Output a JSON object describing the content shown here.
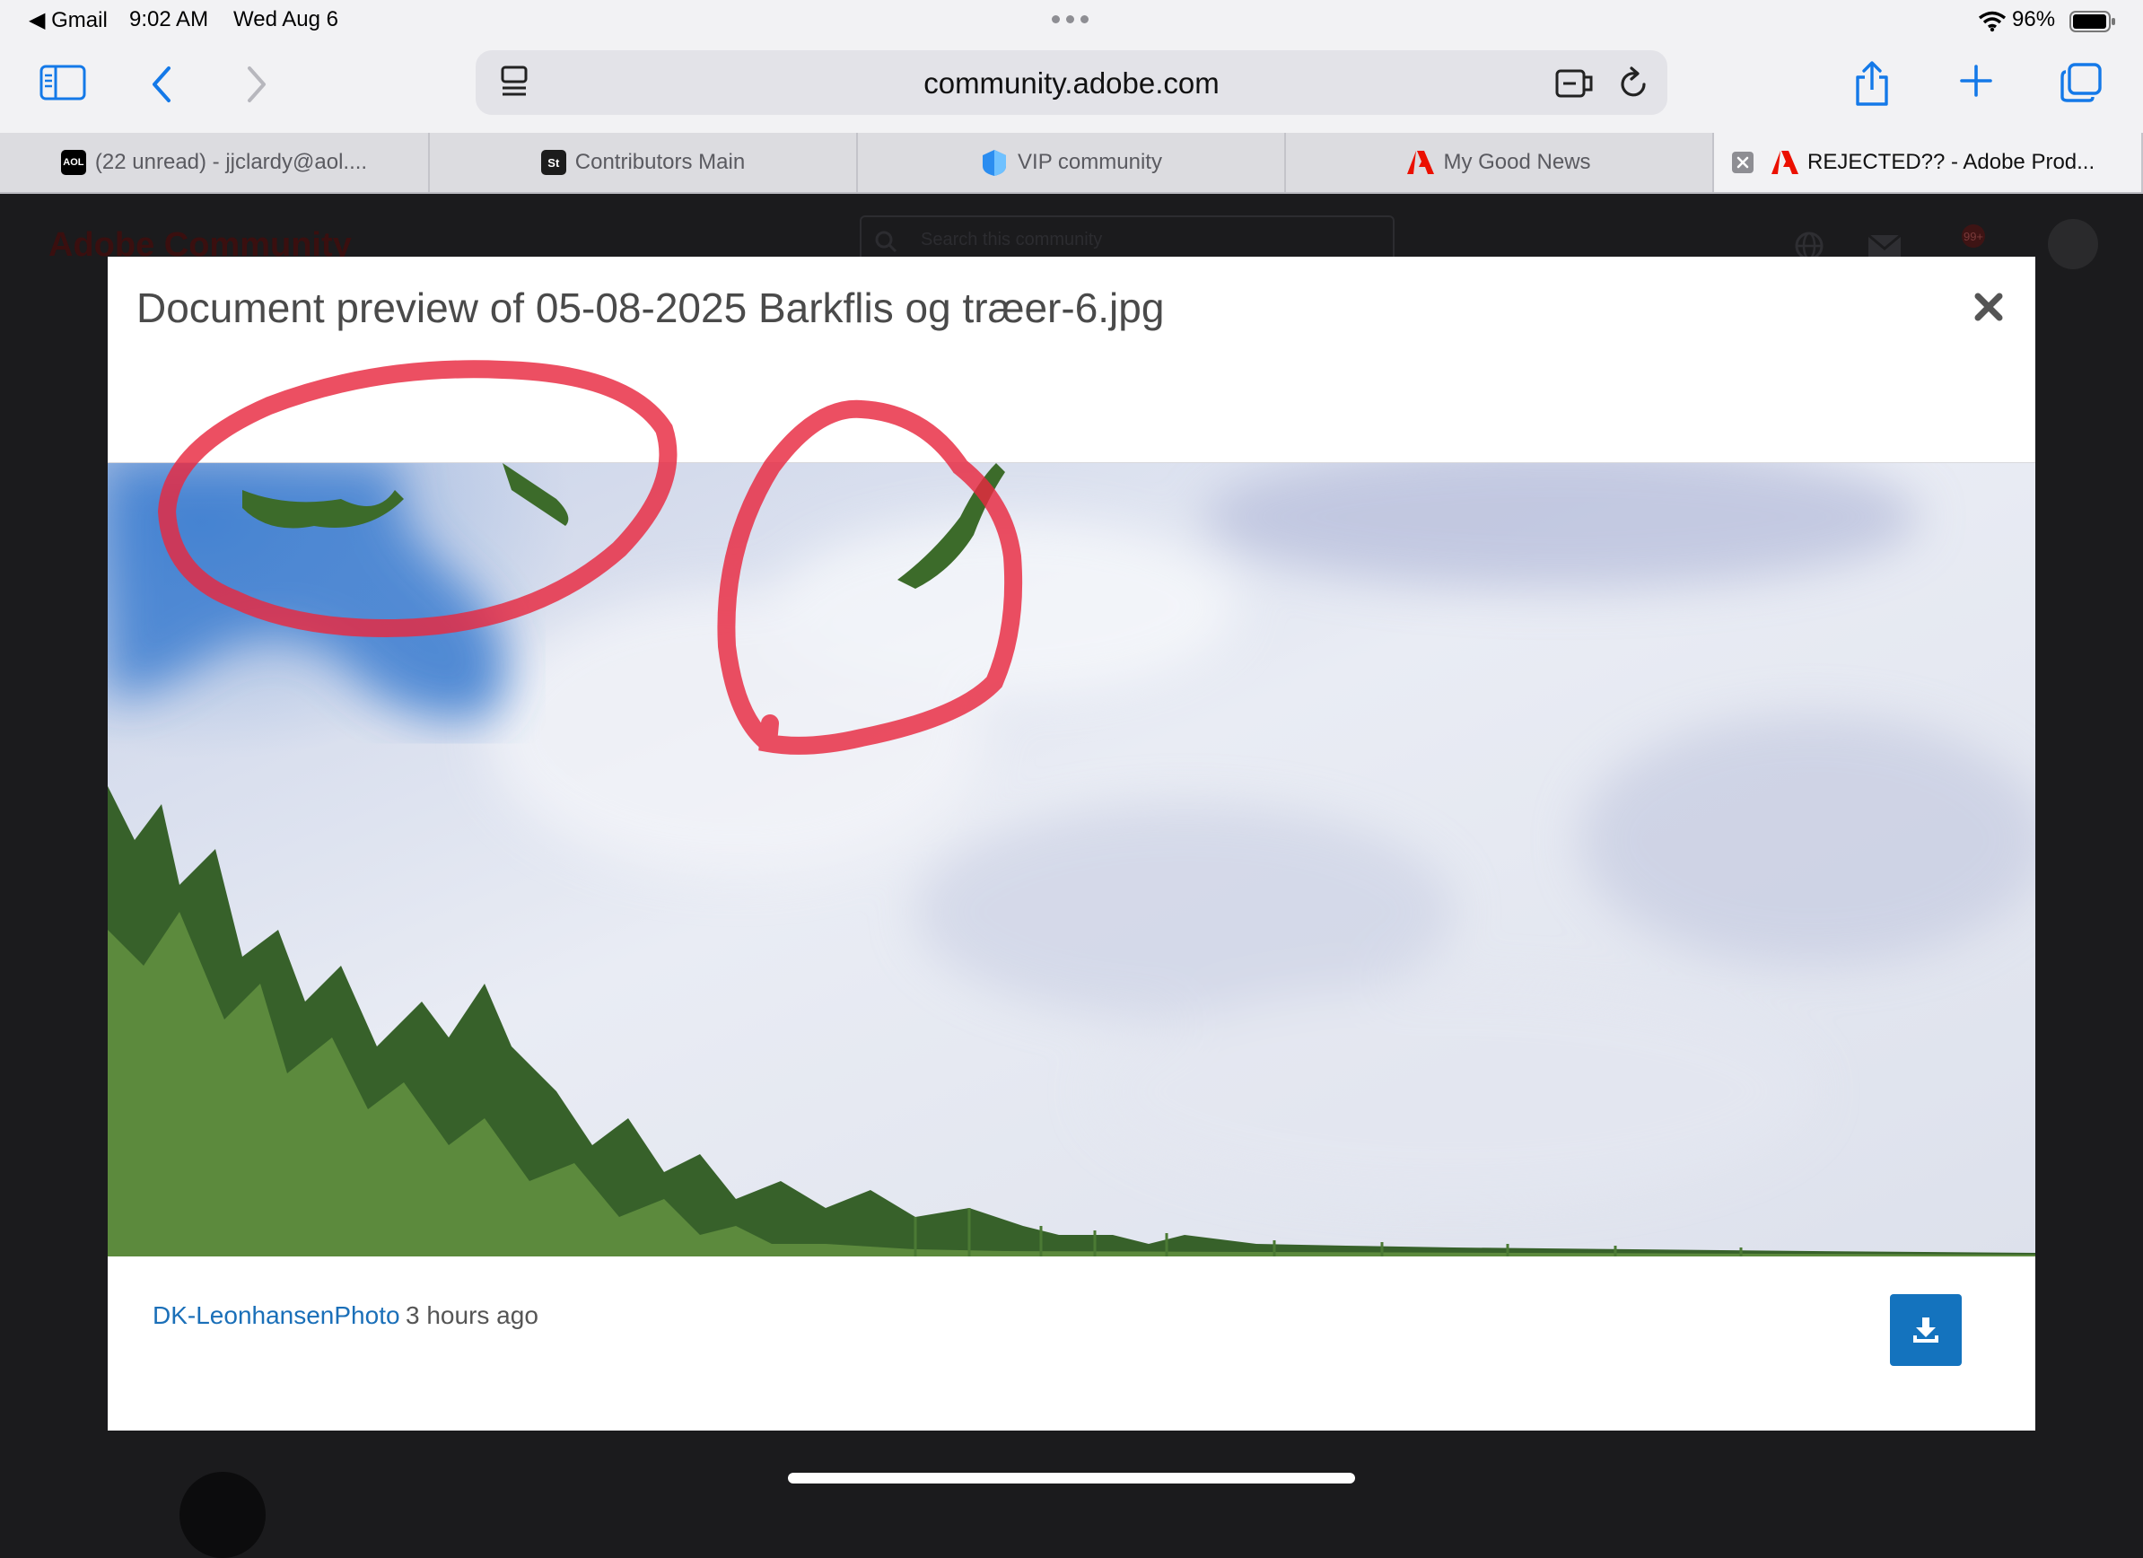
{
  "status_bar": {
    "back_app": "◀ Gmail",
    "time": "9:02 AM",
    "date": "Wed Aug 6",
    "battery": "96%"
  },
  "browser": {
    "url": "community.adobe.com"
  },
  "tabs": [
    {
      "label": "(22 unread) - jjclardy@aol....",
      "icon": "aol-icon",
      "icon_text": "AOL"
    },
    {
      "label": "Contributors Main",
      "icon": "stock-icon",
      "icon_text": "St"
    },
    {
      "label": "VIP community",
      "icon": "vip-icon"
    },
    {
      "label": "My Good News",
      "icon": "adobe-icon"
    },
    {
      "label": "REJECTED?? - Adobe Prod...",
      "icon": "adobe-icon",
      "active": true
    }
  ],
  "background_page": {
    "logo": "Adobe Community",
    "search_placeholder": "Search this community",
    "notification_badge": "99+"
  },
  "modal": {
    "title": "Document preview of 05-08-2025 Barkflis og træer-6.jpg",
    "author": "DK-LeonhansenPhoto",
    "time_ago": "3 hours ago"
  },
  "colors": {
    "link": "#1a6fb8",
    "download_button": "#1473be",
    "annotation": "#e8283f",
    "adobe_red": "#eb1000"
  }
}
